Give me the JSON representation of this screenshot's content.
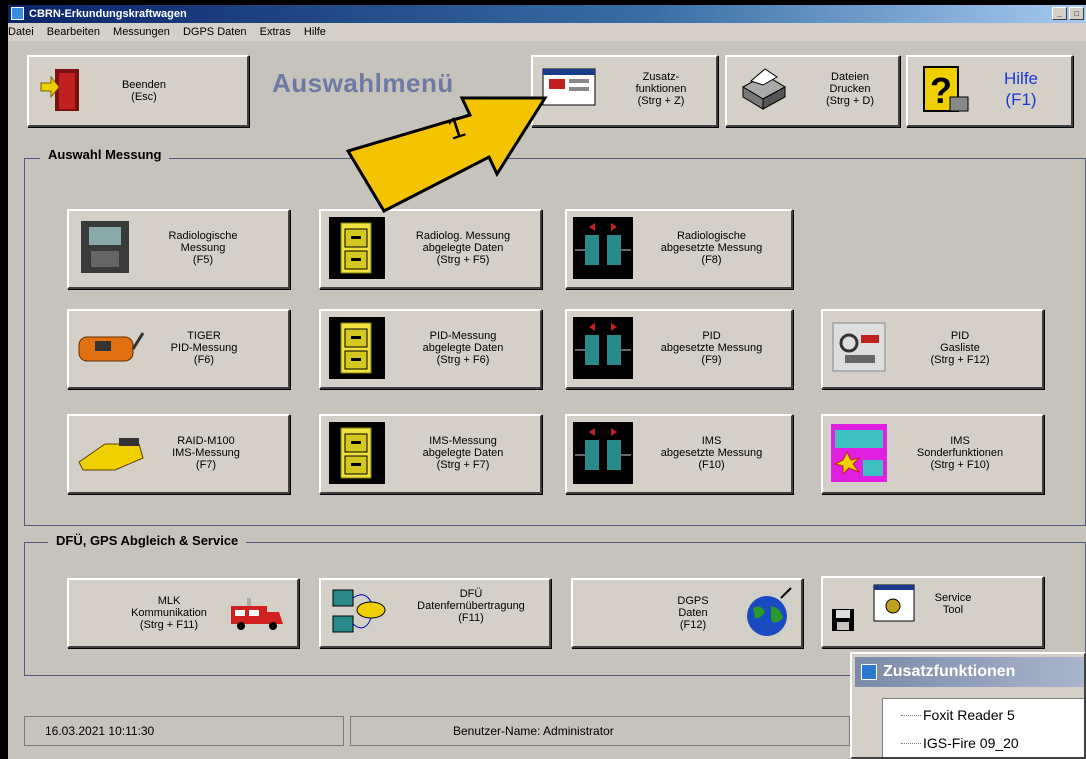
{
  "window": {
    "title": "CBRN-Erkundungskraftwagen",
    "controls": [
      "_",
      "□"
    ]
  },
  "menu": [
    "Datei",
    "Bearbeiten",
    "Messungen",
    "DGPS Daten",
    "Extras",
    "Hilfe"
  ],
  "toolbar": {
    "exit": "Beenden\n(Esc)",
    "headline": "Auswahlmenü",
    "extra": "Zusatz-\nfunktionen\n(Strg + Z)",
    "print": "Dateien\nDrucken\n(Strg + D)",
    "help": "Hilfe\n(F1)"
  },
  "annotation": {
    "number": "1",
    "color": "#f5c400"
  },
  "groups": {
    "measure": "Auswahl Messung",
    "service": "DFÜ, GPS Abgleich & Service"
  },
  "buttons": {
    "radio": "Radiologische\nMessung\n(F5)",
    "radio_saved": "Radiolog. Messung\nabgelegte Daten\n(Strg + F5)",
    "radio_remote": "Radiologische\nabgesetzte Messung\n(F8)",
    "tiger": "TIGER\nPID-Messung\n(F6)",
    "pid_saved": "PID-Messung\nabgelegte Daten\n(Strg + F6)",
    "pid_remote": "PID\nabgesetzte Messung\n(F9)",
    "pid_gas": "PID\nGasliste\n(Strg + F12)",
    "raid": "RAID-M100\nIMS-Messung\n(F7)",
    "ims_saved": "IMS-Messung\nabgelegte Daten\n(Strg + F7)",
    "ims_remote": "IMS\nabgesetzte Messung\n(F10)",
    "ims_special": "IMS\nSonderfunktionen\n(Strg + F10)",
    "mlk": "MLK\nKommunikation\n(Strg + F11)",
    "dfu": "DFÜ\nDatenfernübertragung\n(F11)",
    "dgps": "DGPS\nDaten\n(F12)",
    "service": "Service\nTool"
  },
  "status": {
    "datetime": "16.03.2021 10:11:30",
    "user": "Benutzer-Name: Administrator"
  },
  "popup": {
    "title": "Zusatzfunktionen",
    "items": [
      "Foxit Reader 5",
      "IGS-Fire 09_20"
    ]
  }
}
